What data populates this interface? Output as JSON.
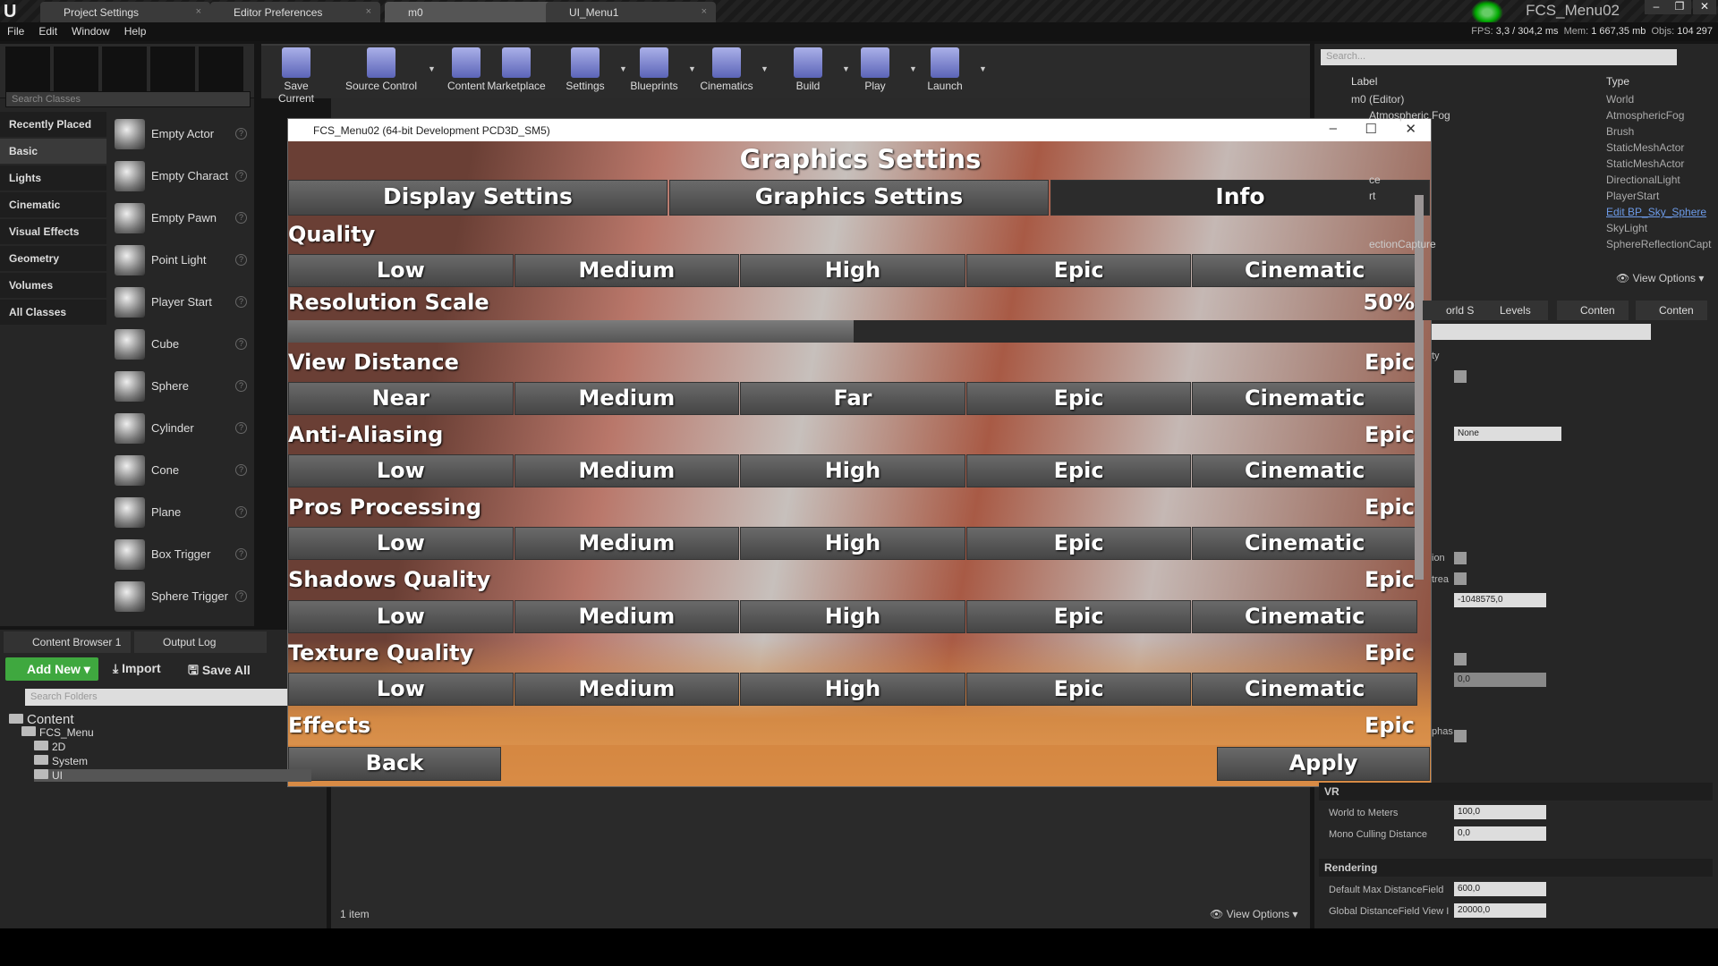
{
  "tabs": [
    {
      "label": "Project Settings"
    },
    {
      "label": "Editor Preferences"
    },
    {
      "label": "m0",
      "active": true
    },
    {
      "label": "UI_Menu1"
    }
  ],
  "app_name": "FCS_Menu02",
  "menu": [
    "File",
    "Edit",
    "Window",
    "Help"
  ],
  "stats": {
    "fps_label": "FPS:",
    "fps": "3,3 / 304,2 ms",
    "mem_label": "Mem:",
    "mem": "1 667,35 mb",
    "objs_label": "Objs:",
    "objs": "104 297"
  },
  "toolbar": [
    {
      "label": "Save Current"
    },
    {
      "label": "Source Control",
      "dropdown": true
    },
    {
      "label": "Content"
    },
    {
      "label": "Marketplace"
    },
    {
      "label": "Settings",
      "dropdown": true
    },
    {
      "label": "Blueprints",
      "dropdown": true
    },
    {
      "label": "Cinematics",
      "dropdown": true
    },
    {
      "label": "Build",
      "dropdown": true
    },
    {
      "label": "Play",
      "dropdown": true
    },
    {
      "label": "Launch",
      "dropdown": true
    }
  ],
  "place": {
    "search_placeholder": "Search Classes",
    "categories": [
      "Recently Placed",
      "Basic",
      "Lights",
      "Cinematic",
      "Visual Effects",
      "Geometry",
      "Volumes",
      "All Classes"
    ],
    "selected": "Basic",
    "items": [
      "Empty Actor",
      "Empty Charact",
      "Empty Pawn",
      "Point Light",
      "Player Start",
      "Cube",
      "Sphere",
      "Cylinder",
      "Cone",
      "Plane",
      "Box Trigger",
      "Sphere Trigger"
    ]
  },
  "content_browser": {
    "tabs": [
      "Content Browser 1",
      "Output Log"
    ],
    "add_new": "Add New",
    "import": "Import",
    "save_all": "Save All",
    "search_placeholder": "Search Folders",
    "folders": [
      {
        "name": "Content",
        "level": 0
      },
      {
        "name": "FCS_Menu",
        "level": 1
      },
      {
        "name": "2D",
        "level": 2
      },
      {
        "name": "System",
        "level": 2
      },
      {
        "name": "UI",
        "level": 2,
        "selected": true
      }
    ],
    "item_count": "1 item",
    "view_options": "View Options"
  },
  "game": {
    "window_title": "FCS_Menu02 (64-bit Development PCD3D_SM5)",
    "heading": "Graphics Settins",
    "tabs": [
      "Display Settins",
      "Graphics Settins",
      "Info"
    ],
    "active_tab": "Info",
    "quality_label": "Quality",
    "quality_options": [
      "Low",
      "Medium",
      "High",
      "Epic",
      "Cinematic"
    ],
    "resolution_label": "Resolution Scale",
    "resolution_value": "50%",
    "resolution_fraction": 0.5,
    "sections": [
      {
        "label": "View Distance",
        "value": "Epic",
        "options": [
          "Near",
          "Medium",
          "Far",
          "Epic",
          "Cinematic"
        ]
      },
      {
        "label": "Anti-Aliasing",
        "value": "Epic",
        "options": [
          "Low",
          "Medium",
          "High",
          "Epic",
          "Cinematic"
        ]
      },
      {
        "label": "Pros Processing",
        "value": "Epic",
        "options": [
          "Low",
          "Medium",
          "High",
          "Epic",
          "Cinematic"
        ]
      },
      {
        "label": "Shadows Quality",
        "value": "Epic",
        "options": [
          "Low",
          "Medium",
          "High",
          "Epic",
          "Cinematic"
        ]
      },
      {
        "label": "Texture Quality",
        "value": "Epic",
        "options": [
          "Low",
          "Medium",
          "High",
          "Epic",
          "Cinematic"
        ]
      },
      {
        "label": "Effects",
        "value": "Epic",
        "options": []
      }
    ],
    "back": "Back",
    "apply": "Apply"
  },
  "outliner": {
    "search_placeholder": "Search...",
    "col_label": "Label",
    "col_type": "Type",
    "rows": [
      {
        "label": "m0 (Editor)",
        "type": "World"
      },
      {
        "label": "Atmospheric Fog",
        "type": "AtmosphericFog"
      },
      {
        "label": "",
        "type": "Brush"
      },
      {
        "label": "",
        "type": "StaticMeshActor"
      },
      {
        "label": "",
        "type": "StaticMeshActor"
      },
      {
        "label": "ce",
        "type": "DirectionalLight"
      },
      {
        "label": "rt",
        "type": "PlayerStart"
      },
      {
        "label": "",
        "type": "Edit BP_Sky_Sphere",
        "link": true
      },
      {
        "label": "",
        "type": "SkyLight"
      },
      {
        "label": "ectionCapture",
        "type": "SphereReflectionCapt"
      }
    ],
    "view_options": "View Options"
  },
  "details": {
    "tabs": [
      "orld S",
      "Levels",
      "Conten",
      "Conten"
    ],
    "partial_labels": [
      "ty",
      "ion",
      "trea",
      "phas"
    ],
    "none_select": "None",
    "value_1": "-1048575,0",
    "value_2": "0,0",
    "vr_section": "VR",
    "world_to_meters_label": "World to Meters",
    "world_to_meters": "100,0",
    "mono_label": "Mono Culling Distance",
    "mono": "0,0",
    "rendering_section": "Rendering",
    "dmdf_label": "Default Max DistanceField",
    "dmdf": "600,0",
    "gdfv_label": "Global DistanceField View I",
    "gdfv": "20000,0"
  },
  "colors": {
    "accent_green": "#3fa83f",
    "link": "#6d9be8"
  }
}
